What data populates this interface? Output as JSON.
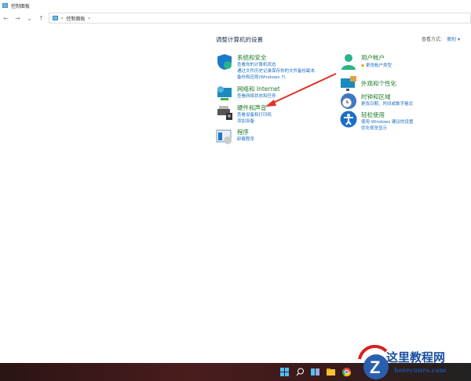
{
  "window": {
    "title": "控制面板"
  },
  "nav": {
    "back": "←",
    "forward": "→",
    "recent": "⌄",
    "up": "↑",
    "breadcrumb": [
      "控制面板"
    ]
  },
  "main": {
    "heading": "调整计算机的设置",
    "view_by_label": "查看方式:",
    "view_by_value": "类别 ▾"
  },
  "categories_left": [
    {
      "title": "系统和安全",
      "links": [
        "查看你的计算机状态",
        "通过文件历史记录保存你的文件备份副本",
        "备份和还原(Windows 7)"
      ]
    },
    {
      "title": "网络和 Internet",
      "links": [
        "查看网络状态和任务"
      ]
    },
    {
      "title": "硬件和声音",
      "links": [
        "查看设备和打印机",
        "添加设备"
      ]
    },
    {
      "title": "程序",
      "links": [
        "卸载程序"
      ]
    }
  ],
  "categories_right": [
    {
      "title": "用户帐户",
      "links": [
        "更改帐户类型"
      ]
    },
    {
      "title": "外观和个性化",
      "links": []
    },
    {
      "title": "时钟和区域",
      "links": [
        "更改日期、时间或数字格式"
      ]
    },
    {
      "title": "轻松使用",
      "links": [
        "使用 Windows 建议的设置",
        "优化视觉显示"
      ]
    }
  ],
  "watermark": {
    "name": "这里教程网",
    "url": "herecours.com"
  },
  "colors": {
    "link": "#1a6ec0",
    "category": "#1f7a2e",
    "arrow": "#e0302a"
  }
}
